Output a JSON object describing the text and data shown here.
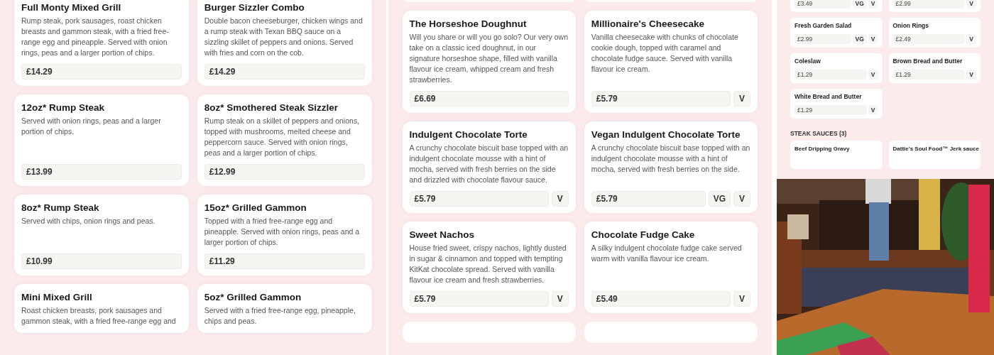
{
  "mains": [
    {
      "name": "Full Monty Mixed Grill",
      "description": "Rump steak, pork sausages, roast chicken breasts and gammon steak, with a fried free-range egg and pineapple. Served with onion rings, peas and a larger portion of chips.",
      "price": "£14.29"
    },
    {
      "name": "Burger Sizzler Combo",
      "description": "Double bacon cheeseburger, chicken wings and a rump steak with Texan BBQ sauce on a sizzling skillet of peppers and onions. Served with fries and corn on the cob.",
      "price": "£14.29"
    },
    {
      "name": "12oz* Rump Steak",
      "description": "Served with onion rings, peas and a larger portion of chips.",
      "price": "£13.99"
    },
    {
      "name": "8oz* Smothered Steak Sizzler",
      "description": "Rump steak on a skillet of peppers and onions, topped with mushrooms, melted cheese and peppercorn sauce. Served with onion rings, peas and a larger portion of chips.",
      "price": "£12.99"
    },
    {
      "name": "8oz* Rump Steak",
      "description": "Served with chips, onion rings and peas.",
      "price": "£10.99"
    },
    {
      "name": "15oz* Grilled Gammon",
      "description": "Topped with a fried free-range egg and pineapple. Served with onion rings, peas and a larger portion of chips.",
      "price": "£11.29"
    },
    {
      "name": "Mini Mixed Grill",
      "description": "Roast chicken breasts, pork sausages and gammon steak, with a fried free-range egg and"
    },
    {
      "name": "5oz* Grilled Gammon",
      "description": "Served with a fried free-range egg, pineapple, chips and peas."
    }
  ],
  "desserts": [
    {
      "name": "The Horseshoe Doughnut",
      "description": "Will you share or will you go solo? Our very own take on a classic iced doughnut, in our signature horseshoe shape, filled with vanilla flavour ice cream, whipped cream and fresh strawberries.",
      "price": "£6.69"
    },
    {
      "name": "Millionaire's Cheesecake",
      "description": "Vanilla cheesecake with chunks of chocolate cookie dough, topped with caramel and chocolate fudge sauce. Served with vanilla flavour ice cream.",
      "price": "£5.79",
      "tags": [
        "V"
      ]
    },
    {
      "name": "Indulgent Chocolate Torte",
      "description": "A crunchy chocolate biscuit base topped with an indulgent chocolate mousse with a hint of mocha, served with fresh berries on the side and drizzled with chocolate flavour sauce.",
      "price": "£5.79",
      "tags": [
        "V"
      ]
    },
    {
      "name": "Vegan Indulgent Chocolate Torte",
      "description": "A crunchy chocolate biscuit base topped with an indulgent chocolate mousse with a hint of mocha, served with fresh berries on the side.",
      "price": "£5.79",
      "tags": [
        "VG",
        "V"
      ]
    },
    {
      "name": "Sweet Nachos",
      "description": "House fried sweet, crispy nachos, lightly dusted in sugar & cinnamon and topped with tempting KitKat chocolate spread. Served with vanilla flavour ice cream and fresh strawberries.",
      "price": "£5.79",
      "tags": [
        "V"
      ]
    },
    {
      "name": "Chocolate Fudge Cake",
      "description": "A silky indulgent chocolate fudge cake served warm with vanilla flavour ice cream.",
      "price": "£5.49",
      "tags": [
        "V"
      ]
    }
  ],
  "sides": [
    {
      "price": "£3.49",
      "tags": [
        "VG",
        "V"
      ]
    },
    {
      "price": "£2.99",
      "tags": [
        "V"
      ]
    },
    {
      "name": "Fresh Garden Salad",
      "price": "£2.99",
      "tags": [
        "VG",
        "V"
      ]
    },
    {
      "name": "Onion Rings",
      "price": "£2.49",
      "tags": [
        "V"
      ]
    },
    {
      "name": "Coleslaw",
      "price": "£1.29",
      "tags": [
        "V"
      ]
    },
    {
      "name": "Brown Bread and Butter",
      "price": "£1.29",
      "tags": [
        "V"
      ]
    },
    {
      "name": "White Bread and Butter",
      "price": "£1.29",
      "tags": [
        "V"
      ]
    }
  ],
  "steak_sauces": {
    "heading": "STEAK SAUCES (3)",
    "items": [
      {
        "name": "Beef Dripping Gravy"
      },
      {
        "name": "Dattie's Soul Food™ Jerk sauce"
      }
    ]
  }
}
